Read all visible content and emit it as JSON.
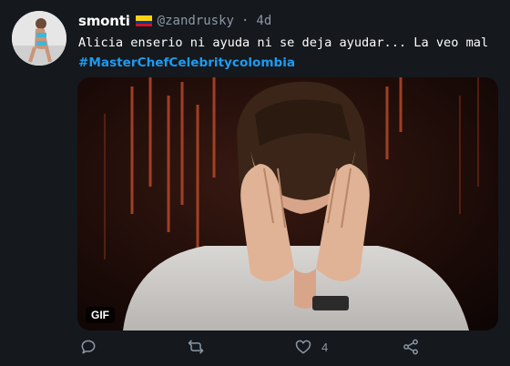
{
  "tweet": {
    "author_name": "smonti",
    "handle": "@zandrusky",
    "separator": "·",
    "time": "4d",
    "text": "Alicia enserio ni ayuda ni se deja ayudar... La veo mal",
    "hashtag": "#MasterChefCelebritycolombia",
    "media_badge": "GIF"
  },
  "actions": {
    "reply_icon": "reply-icon",
    "retweet_icon": "retweet-icon",
    "like_icon": "heart-icon",
    "like_count": "4",
    "share_icon": "share-icon"
  },
  "colors": {
    "background": "#15181c",
    "hashtag": "#1d9bf0",
    "muted": "#8b98a5"
  }
}
